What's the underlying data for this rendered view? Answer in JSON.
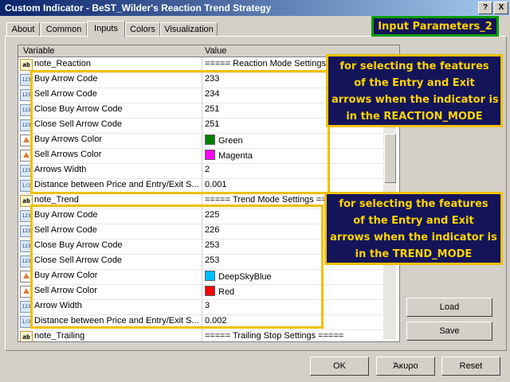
{
  "window": {
    "title": "Custom Indicator - BeST_Wilder's Reaction Trend Strategy",
    "help_label": "?",
    "close_label": "X"
  },
  "tabs": [
    {
      "label": "About"
    },
    {
      "label": "Common"
    },
    {
      "label": "Inputs",
      "active": true
    },
    {
      "label": "Colors"
    },
    {
      "label": "Visualization"
    }
  ],
  "grid": {
    "headers": {
      "variable": "Variable",
      "value": "Value"
    },
    "rows": [
      {
        "icon": "ab",
        "name": "note_Reaction",
        "value": "===== Reaction Mode Settings ="
      },
      {
        "icon": "123",
        "name": "Buy Arrow Code",
        "value": "233"
      },
      {
        "icon": "123",
        "name": "Sell Arrow Code",
        "value": "234"
      },
      {
        "icon": "123",
        "name": "Close Buy Arrow Code",
        "value": "251"
      },
      {
        "icon": "123",
        "name": "Close Sell Arrow Code",
        "value": "251"
      },
      {
        "icon": "color",
        "name": "Buy Arrows Color",
        "value": "Green",
        "swatch": "#008000"
      },
      {
        "icon": "color",
        "name": "Sell Arrows Color",
        "value": "Magenta",
        "swatch": "#ff00ff"
      },
      {
        "icon": "123",
        "name": "Arrows Width",
        "value": "2"
      },
      {
        "icon": "1/2",
        "name": "Distance between Price and Entry/Exit S...",
        "value": "0.001"
      },
      {
        "icon": "ab",
        "name": "note_Trend",
        "value": "===== Trend Mode Settings ===="
      },
      {
        "icon": "123",
        "name": "Buy Arrow Code",
        "value": "225"
      },
      {
        "icon": "123",
        "name": "Sell Arrow Code",
        "value": "226"
      },
      {
        "icon": "123",
        "name": "Close Buy Arrow Code",
        "value": "253"
      },
      {
        "icon": "123",
        "name": "Close Sell Arrow Code",
        "value": "253"
      },
      {
        "icon": "color",
        "name": "Buy Arrow Color",
        "value": "DeepSkyBlue",
        "swatch": "#00bfff"
      },
      {
        "icon": "color",
        "name": "Sell Arrow Color",
        "value": "Red",
        "swatch": "#ff0000"
      },
      {
        "icon": "123",
        "name": "Arrow Width",
        "value": "3"
      },
      {
        "icon": "1/2",
        "name": "Distance between Price and Entry/Exit S...",
        "value": "0.002"
      },
      {
        "icon": "ab",
        "name": "note_Trailing",
        "value": "===== Trailing Stop Settings ====="
      }
    ]
  },
  "annotations": {
    "top_label": "Input Parameters_2",
    "reaction_callout": [
      "for selecting the features",
      "of the Entry and Exit",
      "arrows when the indicator is",
      "in the REACTION_MODE"
    ],
    "trend_callout": [
      "for selecting the features",
      "of the Entry and Exit",
      "arrows when the indicator is",
      "in the TREND_MODE"
    ]
  },
  "side_buttons": {
    "load": "Load",
    "save": "Save"
  },
  "footer_buttons": {
    "ok": "OK",
    "cancel": "Άκυρο",
    "reset": "Reset"
  },
  "colors": {
    "title_bar": "#0a246a",
    "callout_bg": "#14145a",
    "callout_text": "#ffd400",
    "highlight": "#f0c000",
    "top_label_border": "#00a000"
  }
}
